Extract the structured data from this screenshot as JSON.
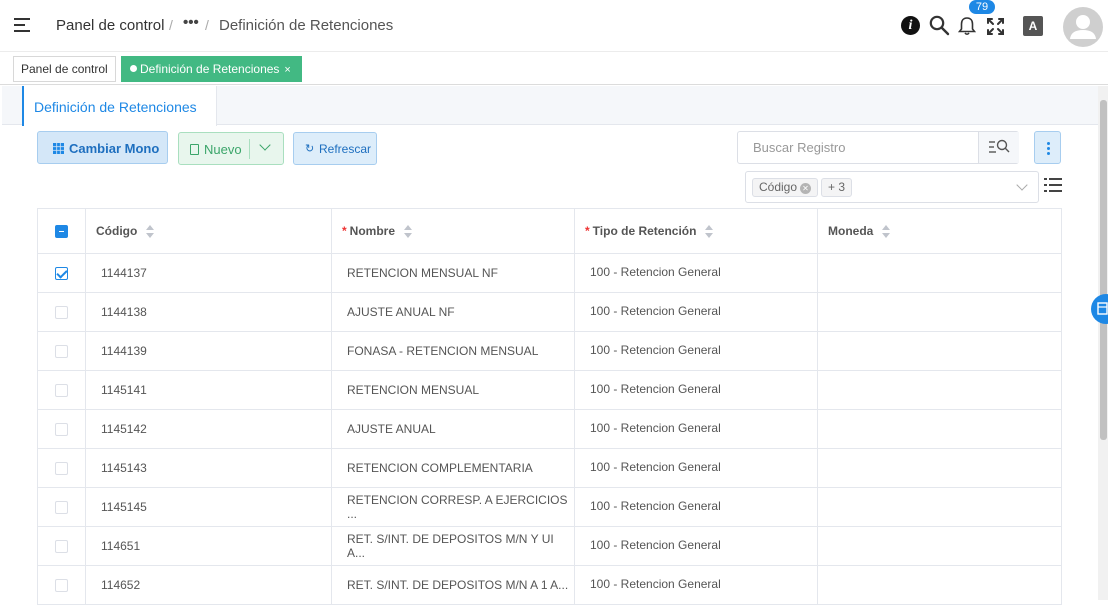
{
  "header": {
    "breadcrumb_home": "Panel de control",
    "breadcrumb_sep": "/",
    "breadcrumb_ellipsis": "•••",
    "breadcrumb_current": "Definición de Retenciones",
    "notifications_count": "79",
    "translate_label": "A"
  },
  "tabs": {
    "home_label": "Panel de control",
    "active_label": "Definición de Retenciones",
    "close_glyph": "×"
  },
  "page": {
    "tab_title": "Definición de Retenciones"
  },
  "toolbar": {
    "switch_label": "Cambiar Mono",
    "new_label": "Nuevo",
    "refresh_label": "Refrescar",
    "refresh_icon": "↻"
  },
  "search": {
    "placeholder": "Buscar Registro"
  },
  "filters": {
    "tag_label": "Código",
    "more_label": "+ 3"
  },
  "table": {
    "columns": {
      "codigo": "Código",
      "nombre": "Nombre",
      "tipo": "Tipo de Retención",
      "moneda": "Moneda",
      "required_mark": "*"
    },
    "rows": [
      {
        "codigo": "1144137",
        "nombre": "RETENCION MENSUAL NF",
        "tipo": "100 - Retencion General",
        "moneda": "",
        "checked": true
      },
      {
        "codigo": "1144138",
        "nombre": "AJUSTE ANUAL NF",
        "tipo": "100 - Retencion General",
        "moneda": "",
        "checked": false
      },
      {
        "codigo": "1144139",
        "nombre": "FONASA - RETENCION MENSUAL",
        "tipo": "100 - Retencion General",
        "moneda": "",
        "checked": false
      },
      {
        "codigo": "1145141",
        "nombre": "RETENCION MENSUAL",
        "tipo": "100 - Retencion General",
        "moneda": "",
        "checked": false
      },
      {
        "codigo": "1145142",
        "nombre": "AJUSTE ANUAL",
        "tipo": "100 - Retencion General",
        "moneda": "",
        "checked": false
      },
      {
        "codigo": "1145143",
        "nombre": "RETENCION COMPLEMENTARIA",
        "tipo": "100 - Retencion General",
        "moneda": "",
        "checked": false
      },
      {
        "codigo": "1145145",
        "nombre": "RETENCION CORRESP. A EJERCICIOS ...",
        "tipo": "100 - Retencion General",
        "moneda": "",
        "checked": false
      },
      {
        "codigo": "114651",
        "nombre": "RET. S/INT. DE DEPOSITOS M/N Y UI A...",
        "tipo": "100 - Retencion General",
        "moneda": "",
        "checked": false
      },
      {
        "codigo": "114652",
        "nombre": "RET. S/INT. DE DEPOSITOS M/N A 1 A...",
        "tipo": "100 - Retencion General",
        "moneda": "",
        "checked": false
      }
    ]
  },
  "colors": {
    "accent": "#1e88e5",
    "tab_active": "#42b983",
    "success": "#3ba56a"
  }
}
